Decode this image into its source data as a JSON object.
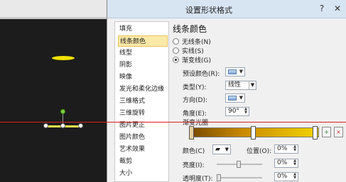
{
  "dialog": {
    "title": "设置形状格式",
    "buttons": {
      "help": "?",
      "close": "✕"
    }
  },
  "nav": {
    "items": [
      {
        "label": "填充"
      },
      {
        "label": "线条颜色",
        "active": true
      },
      {
        "label": "线型"
      },
      {
        "label": "阴影"
      },
      {
        "label": "映像"
      },
      {
        "label": "发光和柔化边缘"
      },
      {
        "label": "三维格式"
      },
      {
        "label": "三维旋转"
      },
      {
        "label": "图片更正"
      },
      {
        "label": "图片颜色"
      },
      {
        "label": "艺术效果"
      },
      {
        "label": "裁剪"
      },
      {
        "label": "大小"
      }
    ]
  },
  "pane": {
    "title": "线条颜色",
    "options": [
      {
        "label": "无线条(N)",
        "checked": false
      },
      {
        "label": "实线(S)",
        "checked": false
      },
      {
        "label": "渐变线(G)",
        "checked": true
      }
    ],
    "preset_label": "预设颜色(R):",
    "type_label": "类型(Y):",
    "type_value": "线性",
    "direction_label": "方向(D):",
    "angle_label": "角度(E):",
    "angle_value": "90°",
    "gradient_label": "渐变光圈",
    "color_label": "颜色(C)",
    "position_label": "位置(O):",
    "position_value": "0%",
    "brightness_label": "亮度(I):",
    "brightness_value": "0%",
    "transparency_label": "透明度(T):",
    "transparency_value": "0%"
  },
  "colors": {
    "gradient_start": "#7a4b00",
    "gradient_mid": "#c98a00",
    "gradient_end": "#f3d400",
    "selection_line": "#f0e24a",
    "guide_line": "#e01b1b"
  },
  "icons": [
    "preset-color-swatch-icon",
    "direction-icon",
    "paint-bucket-icon",
    "add-stop-icon",
    "remove-stop-icon"
  ]
}
